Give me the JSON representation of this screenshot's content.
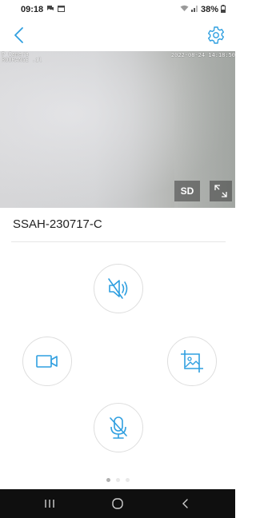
{
  "status_bar": {
    "time": "09:18",
    "battery": "38%",
    "icons": [
      "chat-icon",
      "calendar-icon",
      "wifi-icon",
      "signal-icon",
      "battery-icon"
    ]
  },
  "header": {
    "back_icon": "chevron-left-icon",
    "settings_icon": "gear-icon"
  },
  "video": {
    "camera_label_line1": "P Camera",
    "camera_label_line2": "ROORANGE .ıl",
    "timestamp": "2022-08-24 14:18:50",
    "sd_label": "SD",
    "fullscreen_icon": "expand-icon"
  },
  "device": {
    "name": "SSAH-230717-C"
  },
  "controls": {
    "accent_color": "#2f9fe0",
    "items": [
      "speaker-mute-icon",
      "video-record-icon",
      "snapshot-icon",
      "microphone-icon"
    ]
  },
  "pager": {
    "count": 3,
    "active": 1
  },
  "navbar": {
    "buttons": [
      "recents-icon",
      "home-icon",
      "back-icon"
    ]
  }
}
